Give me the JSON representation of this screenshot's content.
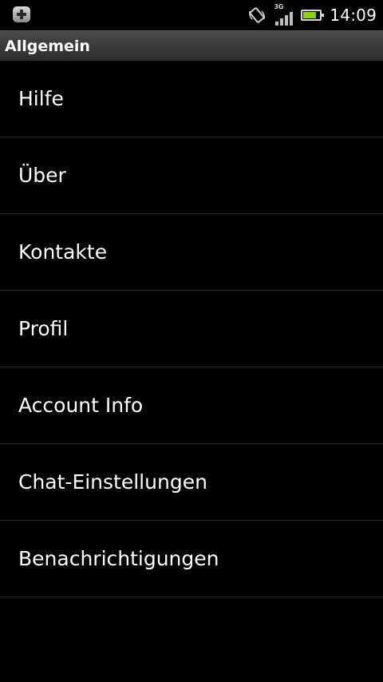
{
  "status_bar": {
    "notification_icon": "plus-notification-icon",
    "rotate_icon": "screen-rotation-icon",
    "network_type": "3G",
    "signal_icon": "signal-strength-icon",
    "battery_icon": "battery-icon",
    "battery_level": 0.8,
    "battery_color": "#8cd400",
    "time": "14:09"
  },
  "header": {
    "title": "Allgemein"
  },
  "menu": {
    "items": [
      {
        "label": "Hilfe"
      },
      {
        "label": "Über"
      },
      {
        "label": "Kontakte"
      },
      {
        "label": "Profil"
      },
      {
        "label": "Account Info"
      },
      {
        "label": "Chat-Einstellungen"
      },
      {
        "label": "Benachrichtigungen"
      }
    ]
  },
  "colors": {
    "background": "#000000",
    "title_bar": "#3a3a3a",
    "divider": "#262626",
    "text": "#ffffff"
  }
}
